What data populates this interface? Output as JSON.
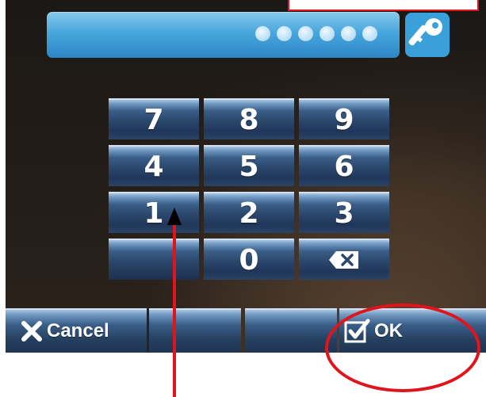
{
  "pin": {
    "digits_entered": 6
  },
  "keypad": {
    "rows": [
      [
        "7",
        "8",
        "9"
      ],
      [
        "4",
        "5",
        "6"
      ],
      [
        "1",
        "2",
        "3"
      ],
      [
        "",
        "0",
        "backspace"
      ]
    ]
  },
  "actions": {
    "cancel_label": "Cancel",
    "ok_label": "OK"
  },
  "icons": {
    "key": "key-icon",
    "backspace": "backspace-icon",
    "cancel": "close-icon",
    "ok": "checkbox-check-icon"
  },
  "colors": {
    "pin_bar": "#48a7dd",
    "button_top": "#a9c6e2",
    "button_bottom": "#1f3553",
    "annotation": "#e1141c"
  }
}
